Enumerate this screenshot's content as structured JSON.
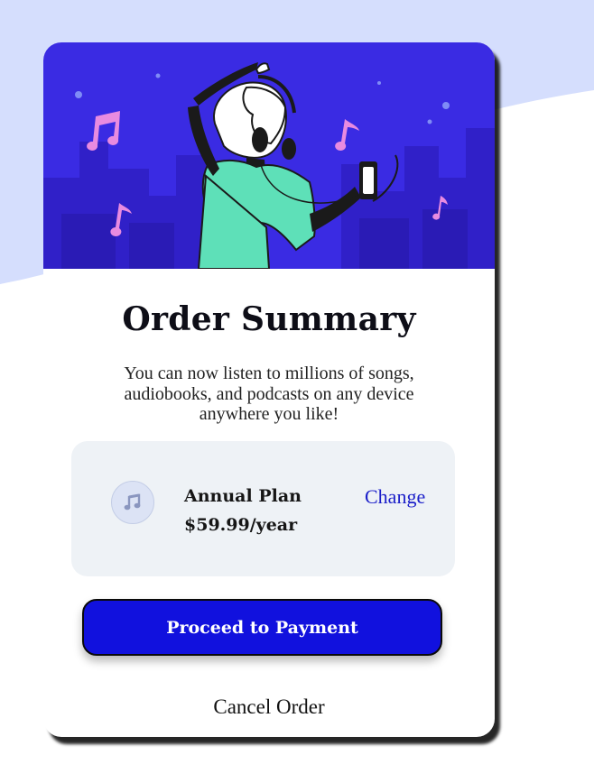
{
  "order": {
    "title": "Order Summary",
    "description": "You can now listen to millions of songs, audiobooks, and podcasts on any device anywhere you like!"
  },
  "plan": {
    "icon": "music-note-icon",
    "name": "Annual Plan",
    "price": "$59.99/year",
    "change_label": "Change"
  },
  "actions": {
    "proceed_label": "Proceed to Payment",
    "cancel_label": "Cancel Order"
  },
  "colors": {
    "page_background": "#d5defd",
    "hero_background": "#3a2be3",
    "primary_button": "#1111de",
    "link": "#1b1fc9",
    "plan_box": "#eef2f6"
  }
}
